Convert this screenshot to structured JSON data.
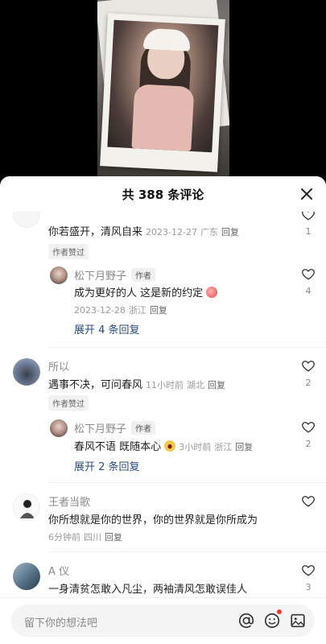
{
  "header": {
    "title": "共 388 条评论",
    "close_icon": "close-icon"
  },
  "comments": [
    {
      "text": "你若盛开，清风自来",
      "date": "2023-12-27",
      "location": "广东",
      "reply": "回复",
      "liked_badge": "作者赞过",
      "likes": "1",
      "sub": {
        "name": "松下月野子",
        "author_tag": "作者",
        "text": "成为更好的人 这是新的约定",
        "emoji": "peach-emoji",
        "date": "2023-12-28",
        "location": "浙江",
        "reply": "回复",
        "likes": "4"
      },
      "expand": "展开 4 条回复"
    },
    {
      "name": "所以",
      "text": "遇事不决，可问春风",
      "time": "11小时前",
      "location": "湖北",
      "reply": "回复",
      "liked_badge": "作者赞过",
      "likes": "2",
      "sub": {
        "name": "松下月野子",
        "author_tag": "作者",
        "text": "春风不语 既随本心",
        "emoji": "scream-emoji",
        "time": "3小时前",
        "location": "浙江",
        "reply": "回复",
        "likes": "2"
      },
      "expand": "展开 2 条回复"
    },
    {
      "name": "王者当歌",
      "text": "你所想就是你的世界，你的世界就是你所成为",
      "time": "6分钟前",
      "location": "四川",
      "reply": "回复"
    },
    {
      "name": "A 仪",
      "text": "一身清贫怎敢入凡尘，两袖清风怎敢误佳人",
      "likes": "3"
    }
  ],
  "input": {
    "placeholder": "留下你的想法吧",
    "icons": [
      "at-icon",
      "emoji-icon",
      "image-icon"
    ]
  },
  "colors": {
    "link": "#2b4a7e",
    "notification_dot": "#f23a3a"
  }
}
